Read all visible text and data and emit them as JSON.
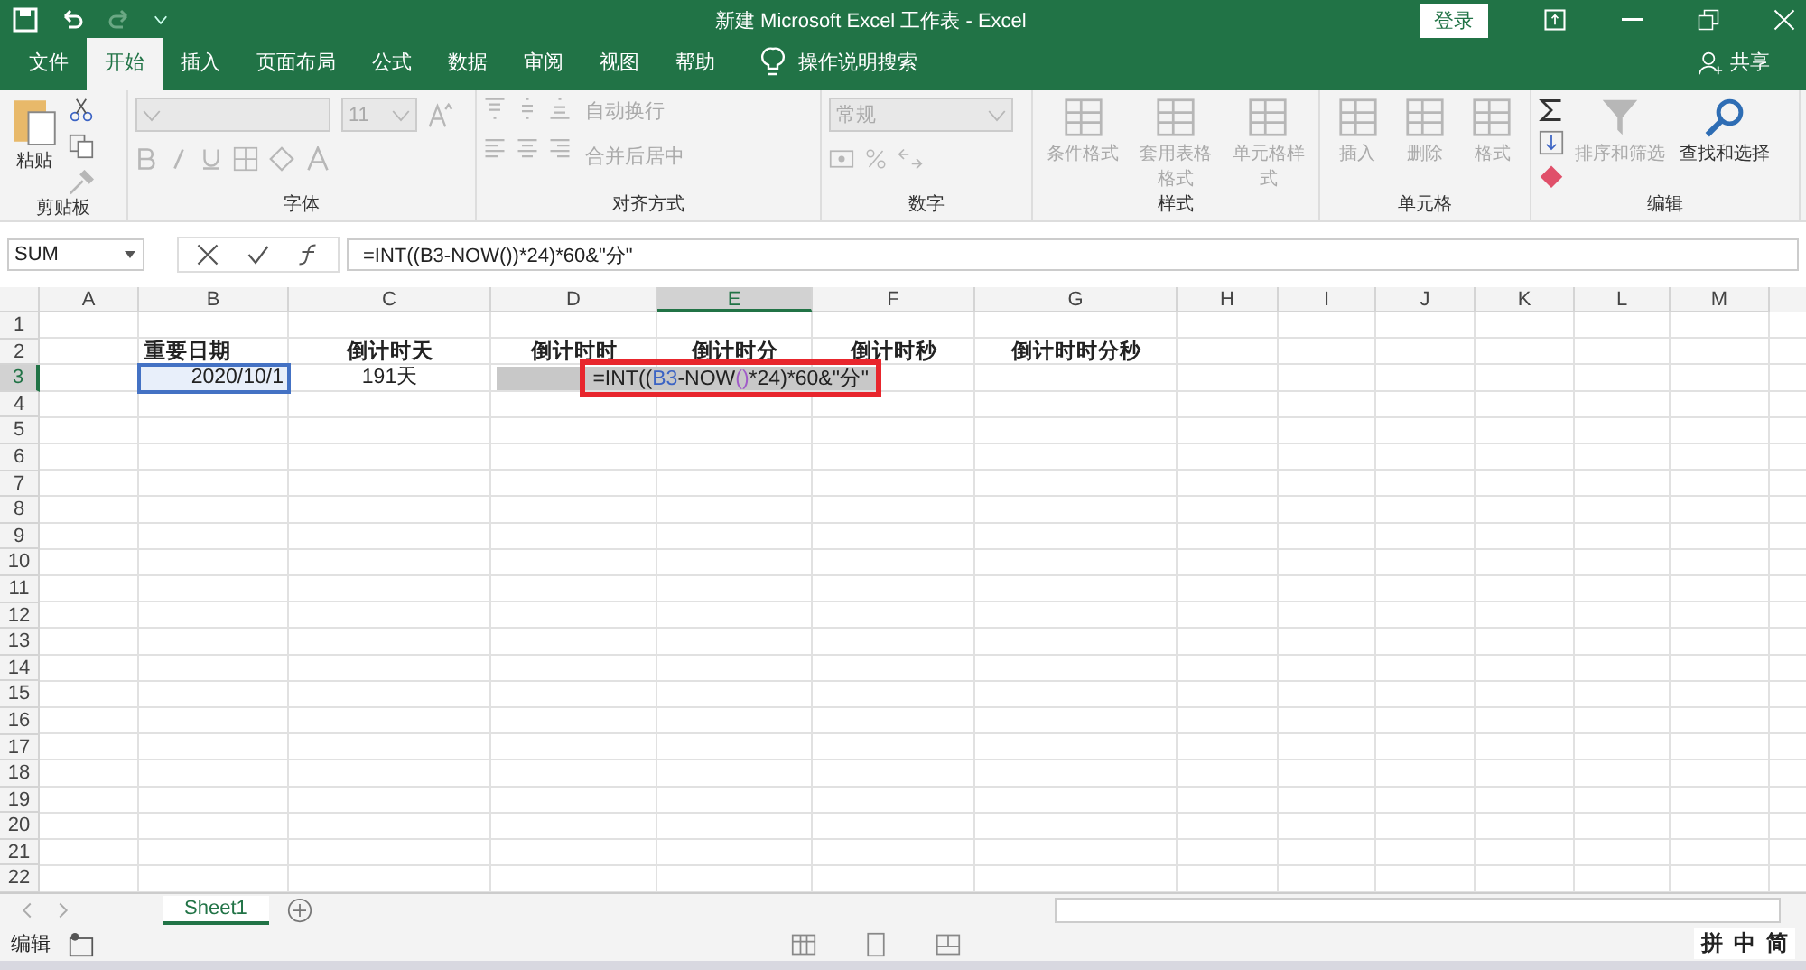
{
  "window": {
    "title": "新建 Microsoft Excel 工作表  -  Excel",
    "login": "登录"
  },
  "tabs": [
    {
      "label": "文件",
      "selected": false
    },
    {
      "label": "开始",
      "selected": true
    },
    {
      "label": "插入",
      "selected": false
    },
    {
      "label": "页面布局",
      "selected": false
    },
    {
      "label": "公式",
      "selected": false
    },
    {
      "label": "数据",
      "selected": false
    },
    {
      "label": "审阅",
      "selected": false
    },
    {
      "label": "视图",
      "selected": false
    },
    {
      "label": "帮助",
      "selected": false
    }
  ],
  "tell_me": "操作说明搜索",
  "share": "共享",
  "ribbon": {
    "clipboard": {
      "label": "剪贴板",
      "paste": "粘贴"
    },
    "font": {
      "label": "字体",
      "size": "11",
      "disabled": true
    },
    "alignment": {
      "label": "对齐方式",
      "wrap": "自动换行",
      "merge": "合并后居中",
      "disabled": true
    },
    "number": {
      "label": "数字",
      "format": "常规",
      "disabled": true
    },
    "styles": {
      "label": "样式",
      "items": [
        {
          "label": "条件格式",
          "disabled": true
        },
        {
          "label": "套用表格格式",
          "disabled": true
        },
        {
          "label": "单元格样式",
          "disabled": true
        }
      ]
    },
    "cells": {
      "label": "单元格",
      "items": [
        {
          "label": "插入",
          "disabled": true
        },
        {
          "label": "删除",
          "disabled": true
        },
        {
          "label": "格式",
          "disabled": true
        }
      ]
    },
    "editing": {
      "label": "编辑",
      "items": [
        {
          "label": "排序和筛选",
          "disabled": true
        },
        {
          "label": "查找和选择",
          "disabled": false
        }
      ]
    }
  },
  "formula_bar": {
    "name_box": "SUM",
    "formula": "=INT((B3-NOW())*24)*60&\"分\""
  },
  "columns": [
    {
      "label": "A",
      "selected": false
    },
    {
      "label": "B",
      "selected": false
    },
    {
      "label": "C",
      "selected": false
    },
    {
      "label": "D",
      "selected": false
    },
    {
      "label": "E",
      "selected": true
    },
    {
      "label": "F",
      "selected": false
    },
    {
      "label": "G",
      "selected": false
    },
    {
      "label": "H",
      "selected": false
    },
    {
      "label": "I",
      "selected": false
    },
    {
      "label": "J",
      "selected": false
    },
    {
      "label": "K",
      "selected": false
    },
    {
      "label": "L",
      "selected": false
    },
    {
      "label": "M",
      "selected": false
    }
  ],
  "rows": [
    {
      "label": "1",
      "selected": false
    },
    {
      "label": "2",
      "selected": false,
      "cells": {
        "B": {
          "text": "重要日期",
          "kind": "label"
        },
        "C": {
          "text": "倒计时天",
          "kind": "centered"
        },
        "D": {
          "text": "倒计时时",
          "kind": "centered"
        },
        "E": {
          "text": "倒计时分",
          "kind": "centered"
        },
        "F": {
          "text": "倒计时秒",
          "kind": "centered"
        },
        "G": {
          "text": "倒计时时分秒",
          "kind": "centered"
        }
      }
    },
    {
      "label": "3",
      "selected": true,
      "cells": {
        "B": {
          "text": "2020/10/1",
          "kind": "number",
          "selected": true
        },
        "C": {
          "text": "191天",
          "kind": "centered"
        }
      }
    },
    {
      "label": "4",
      "selected": false
    },
    {
      "label": "5",
      "selected": false
    },
    {
      "label": "6",
      "selected": false
    },
    {
      "label": "7",
      "selected": false
    },
    {
      "label": "8",
      "selected": false
    },
    {
      "label": "9",
      "selected": false
    },
    {
      "label": "10",
      "selected": false
    },
    {
      "label": "11",
      "selected": false
    },
    {
      "label": "12",
      "selected": false
    },
    {
      "label": "13",
      "selected": false
    },
    {
      "label": "14",
      "selected": false
    },
    {
      "label": "15",
      "selected": false
    },
    {
      "label": "16",
      "selected": false
    },
    {
      "label": "17",
      "selected": false
    },
    {
      "label": "18",
      "selected": false
    },
    {
      "label": "19",
      "selected": false
    },
    {
      "label": "20",
      "selected": false
    },
    {
      "label": "21",
      "selected": false
    },
    {
      "label": "22",
      "selected": false
    }
  ],
  "editing_cell": {
    "segments": [
      {
        "text": "=INT((",
        "kind": "plain"
      },
      {
        "text": "B3",
        "kind": "ref"
      },
      {
        "text": "-NOW",
        "kind": "plain"
      },
      {
        "text": "()",
        "kind": "paren"
      },
      {
        "text": "*24)*60&\"分\"",
        "kind": "plain"
      }
    ]
  },
  "sheets": [
    {
      "label": "Sheet1",
      "selected": true
    }
  ],
  "status_bar": {
    "mode": "编辑",
    "ime": [
      "拼",
      "中",
      "简"
    ]
  }
}
